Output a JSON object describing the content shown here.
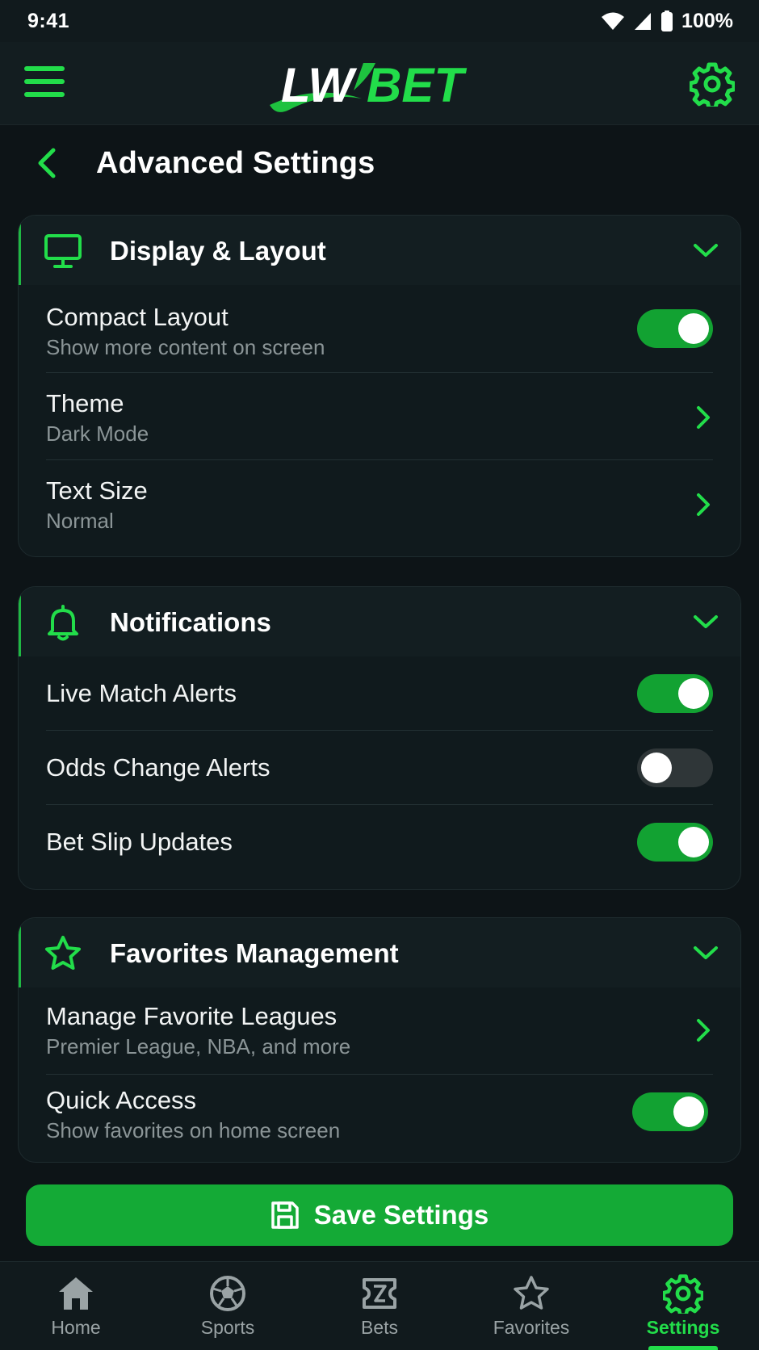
{
  "status_bar": {
    "time": "9:41",
    "battery": "100%"
  },
  "header": {
    "logo_text_left": "LW",
    "logo_text_right": "BET",
    "brand_color": "#22dd4a"
  },
  "page": {
    "title": "Advanced Settings"
  },
  "sections": {
    "display": {
      "title": "Display & Layout",
      "icon": "monitor-icon",
      "compact_layout": {
        "label": "Compact Layout",
        "sub": "Show more content on screen",
        "enabled": true
      },
      "theme": {
        "label": "Theme",
        "value": "Dark Mode"
      },
      "text_size": {
        "label": "Text Size",
        "value": "Normal"
      }
    },
    "notifications": {
      "title": "Notifications",
      "icon": "bell-icon",
      "live_match": {
        "label": "Live Match Alerts",
        "enabled": true
      },
      "odds_change": {
        "label": "Odds Change Alerts",
        "enabled": false
      },
      "bet_slip": {
        "label": "Bet Slip Updates",
        "enabled": true
      }
    },
    "favorites": {
      "title": "Favorites Management",
      "icon": "star-icon",
      "manage_leagues": {
        "label": "Manage Favorite Leagues",
        "sub": "Premier League, NBA, and more"
      },
      "quick_access": {
        "label": "Quick Access",
        "sub": "Show favorites on home screen",
        "enabled": true
      }
    }
  },
  "save_button": {
    "label": "Save Settings"
  },
  "bottom_nav": {
    "items": [
      {
        "label": "Home",
        "icon": "home-icon"
      },
      {
        "label": "Sports",
        "icon": "soccer-ball-icon"
      },
      {
        "label": "Bets",
        "icon": "ticket-icon"
      },
      {
        "label": "Favorites",
        "icon": "star-icon"
      },
      {
        "label": "Settings",
        "icon": "gear-icon",
        "active": true
      }
    ]
  }
}
